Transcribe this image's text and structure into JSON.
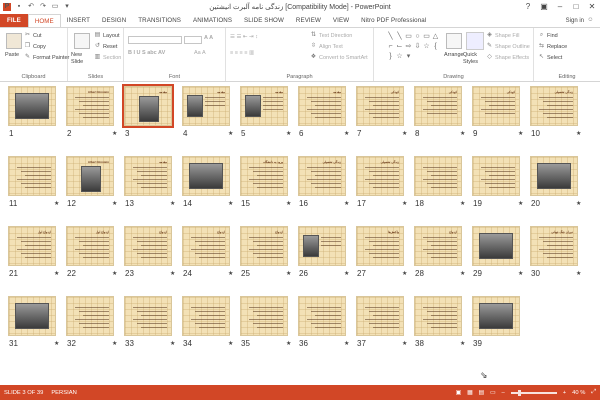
{
  "app": {
    "logo_letter": "P",
    "title": "زندگی نامه آلبرت انیشتین [Compatibility Mode] - PowerPoint",
    "sign_in": "Sign in"
  },
  "tabs": [
    "FILE",
    "HOME",
    "INSERT",
    "DESIGN",
    "TRANSITIONS",
    "ANIMATIONS",
    "SLIDE SHOW",
    "REVIEW",
    "VIEW",
    "Nitro PDF Professional"
  ],
  "active_tab": "HOME",
  "ribbon": {
    "clipboard": {
      "paste": "Paste",
      "cut": "Cut",
      "copy": "Copy",
      "format_painter": "Format Painter",
      "label": "Clipboard"
    },
    "slides": {
      "new_slide": "New Slide",
      "layout": "Layout",
      "reset": "Reset",
      "section": "Section",
      "label": "Slides"
    },
    "font": {
      "label": "Font"
    },
    "paragraph": {
      "text_direction": "Text Direction",
      "align_text": "Align Text",
      "convert_smartart": "Convert to SmartArt",
      "label": "Paragraph"
    },
    "drawing": {
      "arrange": "Arrange",
      "quick_styles": "Quick Styles",
      "shape_fill": "Shape Fill",
      "shape_outline": "Shape Outline",
      "shape_effects": "Shape Effects",
      "label": "Drawing"
    },
    "editing": {
      "find": "Find",
      "replace": "Replace",
      "select": "Select",
      "label": "Editing"
    }
  },
  "slides": [
    {
      "n": "1",
      "star": false,
      "title": "",
      "photo": true,
      "lines": 0
    },
    {
      "n": "2",
      "star": true,
      "title": "Albert Einstein",
      "photo": false,
      "lines": 6
    },
    {
      "n": "3",
      "star": false,
      "title": "مقدمه",
      "photo": true,
      "lines": 0,
      "selected": true
    },
    {
      "n": "4",
      "star": true,
      "title": "مقدمه",
      "photo": true,
      "lines": 3
    },
    {
      "n": "5",
      "star": true,
      "title": "مقدمه",
      "photo": true,
      "lines": 4
    },
    {
      "n": "6",
      "star": true,
      "title": "مقدمه",
      "photo": false,
      "lines": 6
    },
    {
      "n": "7",
      "star": true,
      "title": "کودکی",
      "photo": false,
      "lines": 6
    },
    {
      "n": "8",
      "star": true,
      "title": "کودکی",
      "photo": false,
      "lines": 5
    },
    {
      "n": "9",
      "star": true,
      "title": "کودکی",
      "photo": false,
      "lines": 5
    },
    {
      "n": "10",
      "star": true,
      "title": "زندگی تحصیلی",
      "photo": false,
      "lines": 6
    },
    {
      "n": "11",
      "star": true,
      "title": "",
      "photo": false,
      "lines": 6
    },
    {
      "n": "12",
      "star": true,
      "title": "Albert Einstein",
      "photo": true,
      "lines": 0
    },
    {
      "n": "13",
      "star": true,
      "title": "مقدمه",
      "photo": false,
      "lines": 6
    },
    {
      "n": "14",
      "star": true,
      "title": "",
      "photo": true,
      "lines": 0
    },
    {
      "n": "15",
      "star": true,
      "title": "ورود به دانشگاه",
      "photo": false,
      "lines": 6
    },
    {
      "n": "16",
      "star": true,
      "title": "زندگی تحصیلی",
      "photo": false,
      "lines": 6
    },
    {
      "n": "17",
      "star": true,
      "title": "زندگی تحصیلی",
      "photo": false,
      "lines": 6
    },
    {
      "n": "18",
      "star": true,
      "title": "",
      "photo": false,
      "lines": 6
    },
    {
      "n": "19",
      "star": true,
      "title": "",
      "photo": false,
      "lines": 6
    },
    {
      "n": "20",
      "star": true,
      "title": "",
      "photo": true,
      "lines": 0
    },
    {
      "n": "21",
      "star": true,
      "title": "ازدواج اول",
      "photo": false,
      "lines": 6
    },
    {
      "n": "22",
      "star": true,
      "title": "ازدواج اول",
      "photo": false,
      "lines": 6
    },
    {
      "n": "23",
      "star": true,
      "title": "ازدواج",
      "photo": false,
      "lines": 6
    },
    {
      "n": "24",
      "star": true,
      "title": "ازدواج",
      "photo": false,
      "lines": 6
    },
    {
      "n": "25",
      "star": true,
      "title": "ازدواج",
      "photo": false,
      "lines": 6
    },
    {
      "n": "26",
      "star": true,
      "title": "",
      "photo": true,
      "lines": 3
    },
    {
      "n": "27",
      "star": true,
      "title": "واکنش‌ها",
      "photo": false,
      "lines": 6
    },
    {
      "n": "28",
      "star": true,
      "title": "ازدواج",
      "photo": false,
      "lines": 6
    },
    {
      "n": "29",
      "star": true,
      "title": "",
      "photo": true,
      "lines": 0
    },
    {
      "n": "30",
      "star": true,
      "title": "دوران جنگ جهانی",
      "photo": false,
      "lines": 6
    },
    {
      "n": "31",
      "star": true,
      "title": "",
      "photo": true,
      "lines": 0
    },
    {
      "n": "32",
      "star": true,
      "title": "",
      "photo": false,
      "lines": 6
    },
    {
      "n": "33",
      "star": true,
      "title": "",
      "photo": false,
      "lines": 6
    },
    {
      "n": "34",
      "star": true,
      "title": "",
      "photo": false,
      "lines": 6
    },
    {
      "n": "35",
      "star": true,
      "title": "",
      "photo": false,
      "lines": 6
    },
    {
      "n": "36",
      "star": true,
      "title": "",
      "photo": false,
      "lines": 6
    },
    {
      "n": "37",
      "star": true,
      "title": "",
      "photo": false,
      "lines": 6
    },
    {
      "n": "38",
      "star": true,
      "title": "",
      "photo": false,
      "lines": 6
    },
    {
      "n": "39",
      "star": false,
      "title": "",
      "photo": true,
      "lines": 0
    }
  ],
  "status": {
    "slide": "SLIDE 3 OF 39",
    "language": "PERSIAN",
    "zoom": "40 %",
    "zoom_level": 40
  },
  "colors": {
    "accent": "#d24726"
  }
}
